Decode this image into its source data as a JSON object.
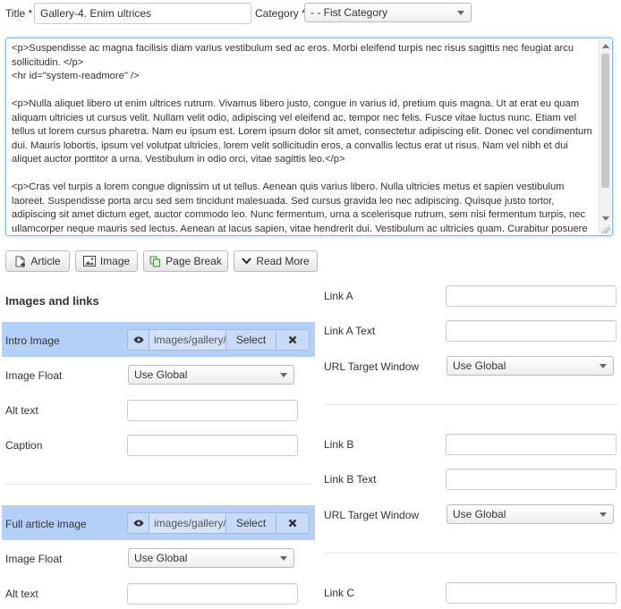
{
  "header": {
    "title_label": "Title *",
    "title_value": "Gallery-4. Enim ultrices",
    "category_label": "Category *",
    "category_value": "- - Fist Category"
  },
  "editor": {
    "content": "<p>Suspendisse ac magna facilisis diam varius vestibulum sed ac eros. Morbi eleifend turpis nec risus sagittis nec feugiat arcu sollicitudin. </p>\n<hr id=\"system-readmore\" />\n\n<p>Nulla aliquet libero ut enim ultrices rutrum. Vivamus libero justo, congue in varius id, pretium quis magna. Ut at erat eu quam aliquam ultricies ut cursus velit. Nullam velit odio, adipiscing vel eleifend ac, tempor nec felis. Fusce vitae luctus nunc. Etiam vel tellus ut lorem cursus pharetra. Nam eu ipsum est. Lorem ipsum dolor sit amet, consectetur adipiscing elit. Donec vel condimentum dui. Mauris lobortis, ipsum vel volutpat ultricies, lorem velit sollicitudin eros, a convallis lectus erat ut risus. Nam vel nibh et dui aliquet auctor porttitor a urna. Vestibulum in odio orci, vitae sagittis leo.</p>\n\n<p>Cras vel turpis a lorem congue dignissim ut ut tellus. Aenean quis varius libero. Nulla ultricies metus et sapien vestibulum laoreet. Suspendisse porta arcu sed sem tincidunt malesuada. Sed cursus gravida leo nec adipiscing. Quisque justo tortor, adipiscing sit amet dictum eget, auctor commodo leo. Nunc fermentum, urna a scelerisque rutrum, sem nisi fermentum turpis, nec ullamcorper neque mauris sed lectus. Aenean at lacus sapien, vitae hendrerit dui. Vestibulum ac ultricies quam. Curabitur posuere"
  },
  "toolbar": {
    "article": "Article",
    "image": "Image",
    "page_break": "Page Break",
    "read_more": "Read More"
  },
  "images": {
    "heading": "Images and links",
    "intro_label": "Intro Image",
    "intro_path": "images/gallery/g",
    "select_label": "Select",
    "float_label": "Image Float",
    "float_value": "Use Global",
    "alt_label": "Alt text",
    "caption_label": "Caption",
    "full_label": "Full article image",
    "full_path": "images/gallery/g",
    "float2_label": "Image Float",
    "float2_value": "Use Global",
    "alt2_label": "Alt text"
  },
  "links": {
    "a_label": "Link A",
    "a_text_label": "Link A Text",
    "target_label": "URL Target Window",
    "target_value": "Use Global",
    "b_label": "Link B",
    "b_text_label": "Link B Text",
    "target_b_label": "URL Target Window",
    "target_b_value": "Use Global",
    "c_label": "Link C"
  },
  "colors": {
    "highlight": "#b4d0f8",
    "editor_focus": "#8ab6d8"
  }
}
